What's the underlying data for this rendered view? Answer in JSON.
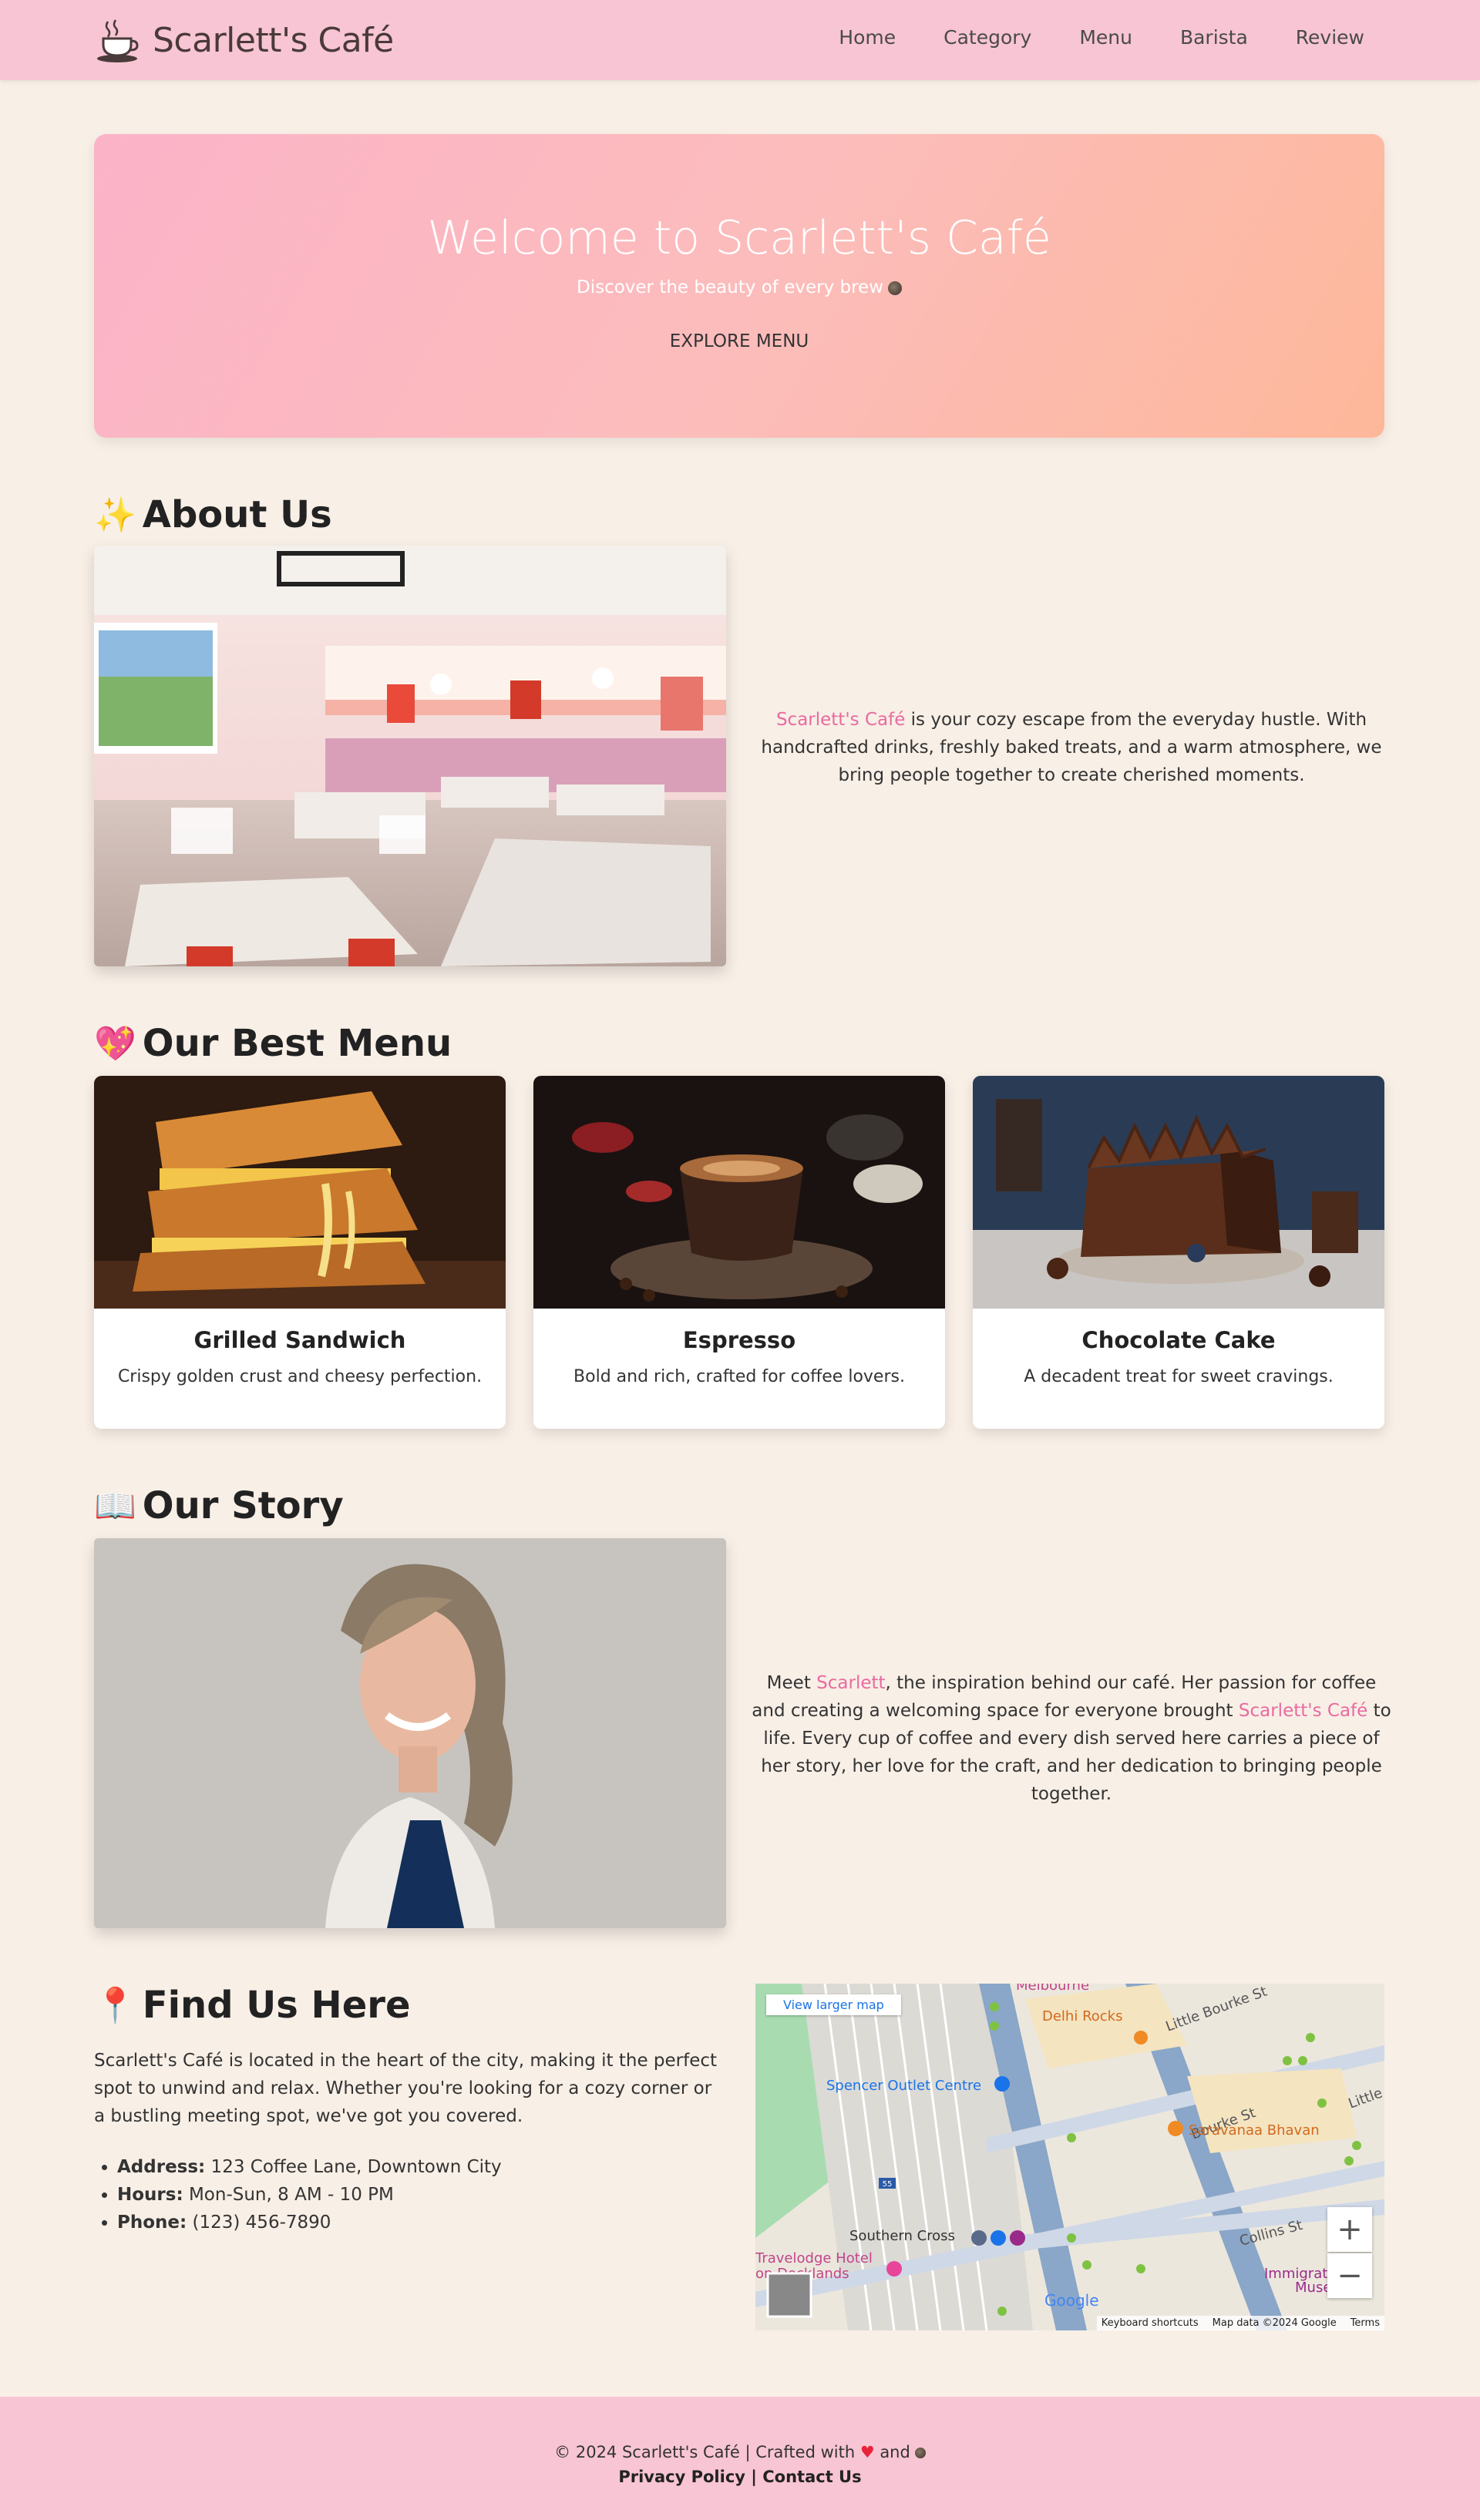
{
  "brand": {
    "name": "Scarlett's Café"
  },
  "nav": {
    "items": [
      "Home",
      "Category",
      "Menu",
      "Barista",
      "Review"
    ]
  },
  "hero": {
    "title": "Welcome to Scarlett's Café",
    "tagline": "Discover the beauty of every brew",
    "button": "EXPLORE MENU"
  },
  "about": {
    "emoji": "✨",
    "title": "About Us",
    "highlight": "Scarlett's Café",
    "text": " is your cozy escape from the everyday hustle. With handcrafted drinks, freshly baked treats, and a warm atmosphere, we bring people together to create cherished moments."
  },
  "menu": {
    "emoji": "💖",
    "title": "Our Best Menu",
    "items": [
      {
        "name": "Grilled Sandwich",
        "desc": "Crispy golden crust and cheesy perfection."
      },
      {
        "name": "Espresso",
        "desc": "Bold and rich, crafted for coffee lovers."
      },
      {
        "name": "Chocolate Cake",
        "desc": "A decadent treat for sweet cravings."
      }
    ]
  },
  "story": {
    "emoji": "📖",
    "title": "Our Story",
    "p1": "Meet ",
    "h1": "Scarlett",
    "p2": ", the inspiration behind our café. Her passion for coffee and creating a welcoming space for everyone brought ",
    "h2": "Scarlett's Café",
    "p3": " to life. Every cup of coffee and every dish served here carries a piece of her story, her love for the craft, and her dedication to bringing people together."
  },
  "find": {
    "emoji": "📍",
    "title": "Find Us Here",
    "text": "Scarlett's Café is located in the heart of the city, making it the perfect spot to unwind and relax. Whether you're looking for a cozy corner or a bustling meeting spot, we've got you covered.",
    "address_label": "Address:",
    "address": " 123 Coffee Lane, Downtown City",
    "hours_label": "Hours:",
    "hours": " Mon-Sun, 8 AM - 10 PM",
    "phone_label": "Phone:",
    "phone": " (123) 456-7890"
  },
  "map": {
    "link": "View larger map",
    "labels": [
      "Melbourne",
      "Delhi Rocks",
      "Little Bourke St",
      "Spencer Outlet Centre",
      "Bourke St",
      "Little",
      "Saravanaa Bhavan",
      "Southern Cross",
      "Collins St",
      "Travelodge Hotel",
      "on Docklands",
      "Immigrati",
      "Museu"
    ],
    "footer": [
      "Keyboard shortcuts",
      "Map data ©2024 Google",
      "Terms"
    ],
    "zoom_in": "+",
    "zoom_out": "−",
    "road_badge": "55",
    "google": "Google"
  },
  "footer": {
    "line1_a": "© 2024 Scarlett's Café | Crafted with ",
    "heart": "♥",
    "line1_b": " and",
    "privacy": "Privacy Policy",
    "sep": " | ",
    "contact": "Contact Us"
  }
}
